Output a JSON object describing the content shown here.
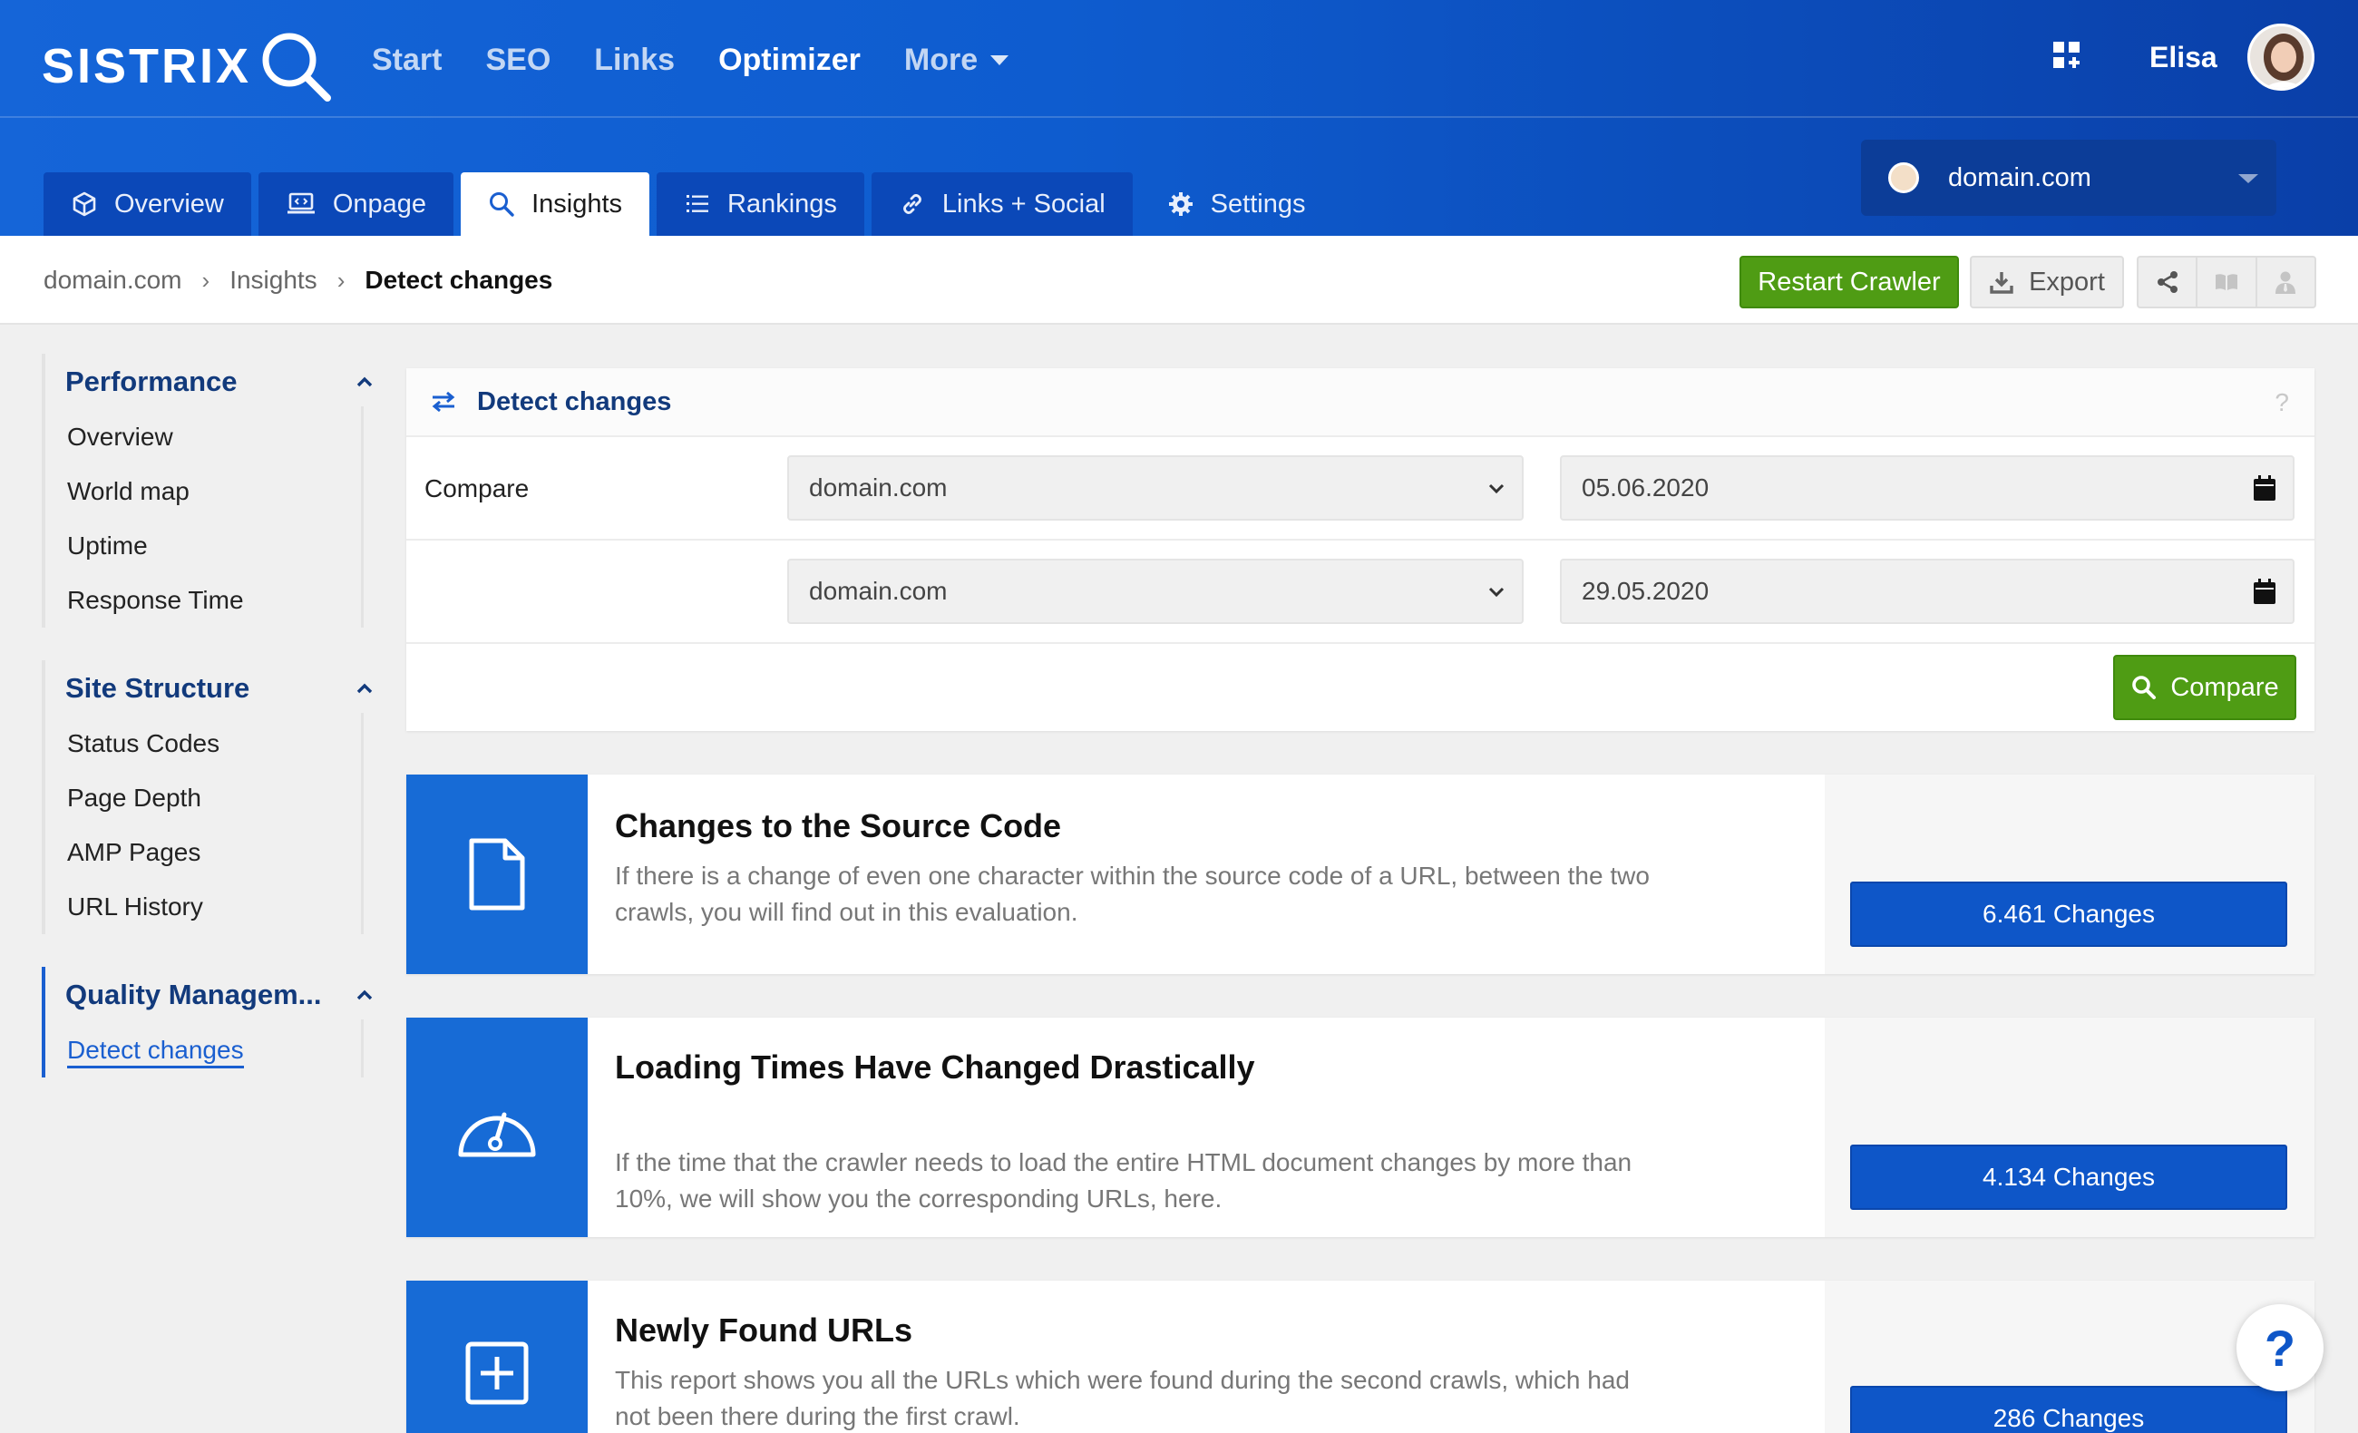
{
  "brand": {
    "logo_text": "SISTRIX"
  },
  "main_nav": [
    {
      "label": "Start"
    },
    {
      "label": "SEO"
    },
    {
      "label": "Links"
    },
    {
      "label": "Optimizer"
    },
    {
      "label": "More"
    }
  ],
  "user": {
    "name": "Elisa"
  },
  "domain_selector": {
    "value": "domain.com"
  },
  "tabs": [
    {
      "label": "Overview",
      "icon": "cube-icon"
    },
    {
      "label": "Onpage",
      "icon": "laptop-code-icon"
    },
    {
      "label": "Insights",
      "icon": "search-icon"
    },
    {
      "label": "Rankings",
      "icon": "list-icon"
    },
    {
      "label": "Links + Social",
      "icon": "link-icon"
    },
    {
      "label": "Settings",
      "icon": "gear-icon"
    }
  ],
  "breadcrumb": [
    "domain.com",
    "Insights",
    "Detect changes"
  ],
  "toolbar": {
    "restart_label": "Restart Crawler",
    "export_label": "Export"
  },
  "sidebar": {
    "groups": [
      {
        "title": "Performance",
        "items": [
          "Overview",
          "World map",
          "Uptime",
          "Response Time"
        ]
      },
      {
        "title": "Site Structure",
        "items": [
          "Status Codes",
          "Page Depth",
          "AMP Pages",
          "URL History"
        ]
      },
      {
        "title": "Quality Managem...",
        "items": [
          "Detect changes"
        ]
      }
    ]
  },
  "compare_panel": {
    "title": "Detect changes",
    "help": "?",
    "row_label": "Compare",
    "rows": [
      {
        "project": "domain.com",
        "date": "05.06.2020"
      },
      {
        "project": "domain.com",
        "date": "29.05.2020"
      }
    ],
    "button_label": "Compare"
  },
  "reports": [
    {
      "title": "Changes to the Source Code",
      "description": "If there is a change of even one character within the source code of a URL, between the two crawls, you will find out in this evaluation.",
      "button": "6.461 Changes",
      "icon": "file-icon"
    },
    {
      "title": "Loading Times Have Changed Drastically",
      "description": "If the time that the crawler needs to load the entire HTML document changes by more than 10%, we will show you the corresponding URLs, here.",
      "button": "4.134 Changes",
      "icon": "speedometer-icon"
    },
    {
      "title": "Newly Found URLs",
      "description": "This report shows you all the URLs which were found during the second crawls, which had not been there during the first crawl.",
      "button": "286 Changes",
      "icon": "plus-square-icon"
    }
  ],
  "help_fab": "?",
  "colors": {
    "header_blue": "#1565d8",
    "active_tab": "#ffffff",
    "green": "#4f9c14",
    "report_blue": "#176bd6",
    "changes_button": "#0e56c8"
  }
}
